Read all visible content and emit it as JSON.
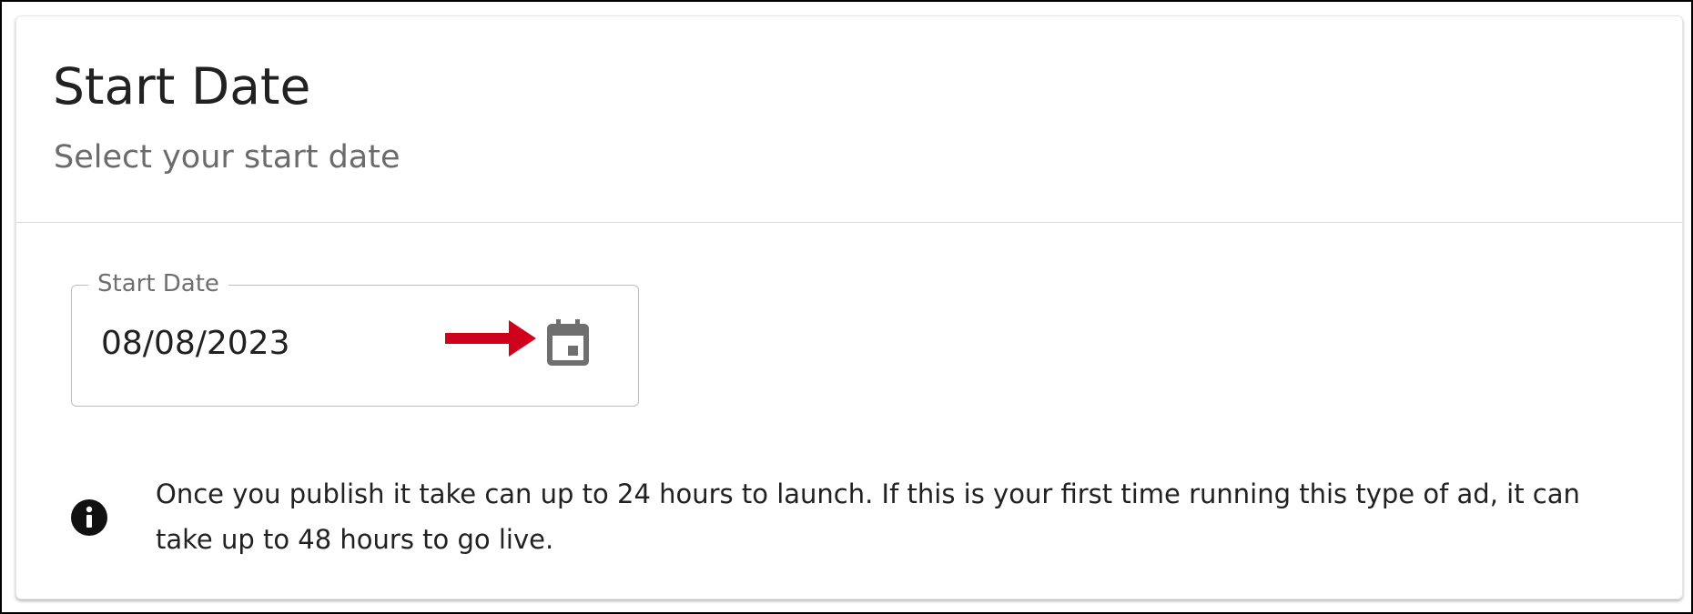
{
  "card": {
    "title": "Start Date",
    "subtitle": "Select your start date"
  },
  "date_field": {
    "label": "Start Date",
    "value": "08/08/2023",
    "icon": "calendar-icon"
  },
  "annotation": {
    "icon": "right-arrow-icon",
    "color": "#d0021b"
  },
  "info": {
    "icon": "info-icon",
    "text": "Once you publish it take can up to 24 hours to launch. If this is your first time running this type of ad, it can take up to 48 hours to go live."
  },
  "colors": {
    "title_text": "#212121",
    "subtitle_text": "#6b6b6b",
    "icon_gray": "#6f6f6f",
    "arrow_red": "#d0021b"
  }
}
